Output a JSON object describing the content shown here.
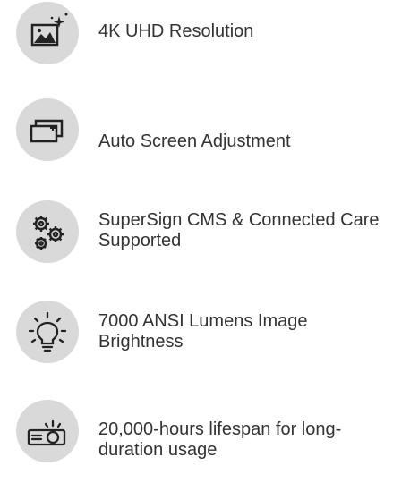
{
  "features": [
    {
      "icon": "image-sparkle-icon",
      "label": "4K UHD Resolution"
    },
    {
      "icon": "screen-adjust-icon",
      "label": "Auto Screen Adjustment"
    },
    {
      "icon": "gears-icon",
      "label": "SuperSign CMS & Connected Care Supported"
    },
    {
      "icon": "lightbulb-icon",
      "label": "7000 ANSI Lumens Image Brightness"
    },
    {
      "icon": "projector-icon",
      "label": "20,000-hours lifespan for long-duration usage"
    }
  ],
  "colors": {
    "icon_background": "#d9d9d9",
    "icon_stroke": "#222222",
    "text": "#333333"
  }
}
